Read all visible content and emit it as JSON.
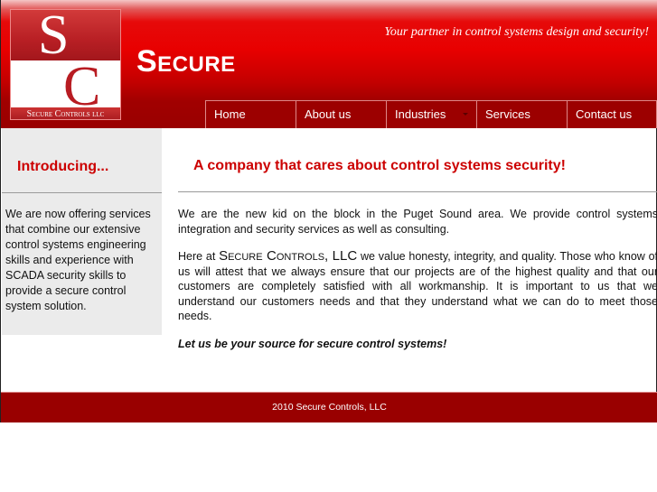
{
  "header": {
    "logo": {
      "letter_top": "S",
      "letter_bottom": "C",
      "caption": "Secure Controls llc"
    },
    "brand": "Secure",
    "tagline": "Your partner in control systems design and security!"
  },
  "nav": {
    "items": [
      {
        "label": "Home",
        "has_dropdown": false
      },
      {
        "label": "About us",
        "has_dropdown": false
      },
      {
        "label": "Industries",
        "has_dropdown": true
      },
      {
        "label": "Services",
        "has_dropdown": false
      },
      {
        "label": "Contact us",
        "has_dropdown": false
      }
    ]
  },
  "sidebar": {
    "title": "Introducing...",
    "text": "We are now offering services that combine our extensive control systems engineering skills and experience with SCADA security skills to provide a secure control system solution."
  },
  "main": {
    "title": "A company that cares about control systems security!",
    "paragraph1": "We are the new kid on the block in the Puget Sound area. We provide control systems integration and security services as well as consulting.",
    "paragraph2_prefix": "Here at ",
    "paragraph2_company": "Secure Controls, LLC",
    "paragraph2_rest": " we value honesty, integrity, and quality. Those who know of us will attest that we always ensure that our projects are of the highest quality and that our customers are completely satisfied with all workmanship. It is important to us that we understand our customers needs and that they understand what we can do to meet those needs.",
    "slogan": "Let us be your source for secure control systems!"
  },
  "footer": {
    "copyright": "2010 Secure Controls, LLC"
  },
  "colors": {
    "brand_red": "#cc0000",
    "nav_bg": "#9c0000",
    "footer_bg": "#990000",
    "sidebar_bg": "#ebebeb"
  }
}
